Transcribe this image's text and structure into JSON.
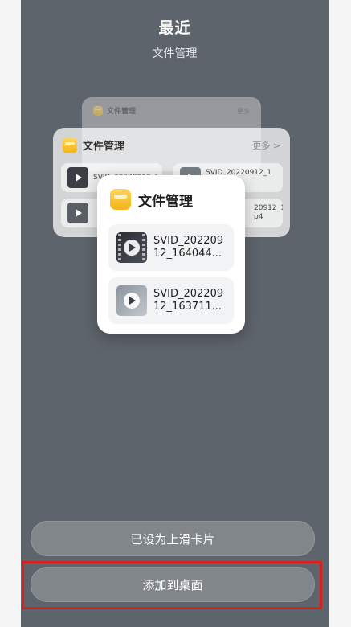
{
  "header": {
    "title": "最近",
    "subtitle": "文件管理"
  },
  "back_card": {
    "app_name": "文件管理",
    "more_label": "更多"
  },
  "middle_card": {
    "app_name": "文件管理",
    "more_label": "更多 >",
    "files": [
      {
        "name_line1": "SVID_20220912_1",
        "name_line2": ""
      },
      {
        "name_line1": "SVID_20220912_1",
        "name_line2": "mp4"
      },
      {
        "name_line1": "",
        "name_line2": ""
      },
      {
        "name_line1": "20912_1",
        "name_line2": "p4"
      }
    ]
  },
  "front_card": {
    "app_name": "文件管理",
    "files": [
      {
        "line1": "SVID_202209",
        "line2": "12_164044..."
      },
      {
        "line1": "SVID_202209",
        "line2": "12_163711..."
      }
    ]
  },
  "buttons": {
    "slide_card": "已设为上滑卡片",
    "add_to_desktop": "添加到桌面"
  },
  "colors": {
    "background": "#5e646b",
    "highlight": "#d9201c",
    "folder_icon": "#f4b516"
  }
}
